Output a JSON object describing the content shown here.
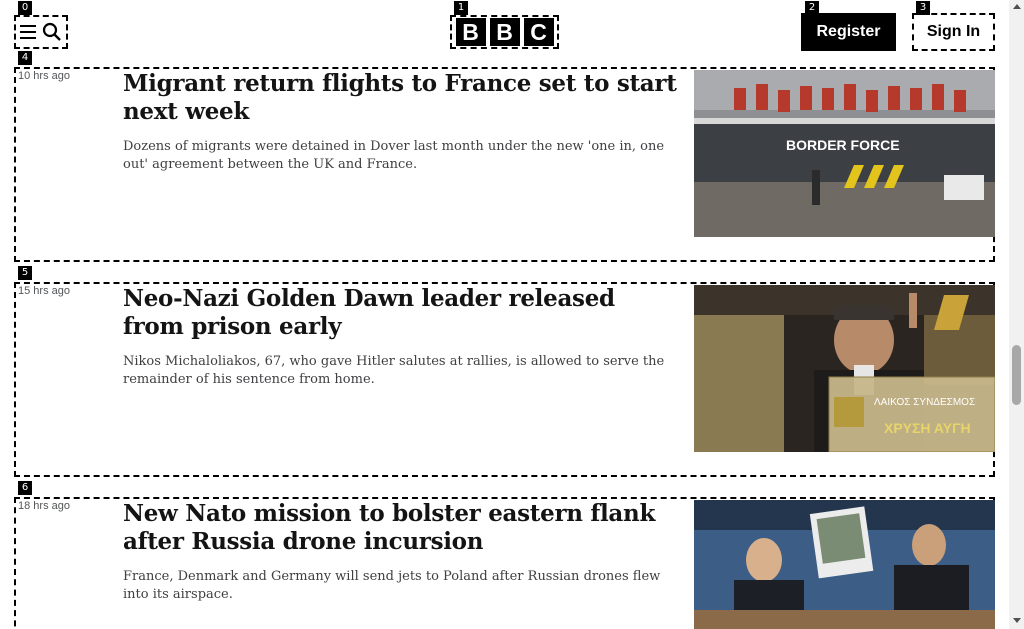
{
  "header": {
    "bbc_letters": [
      "B",
      "B",
      "C"
    ],
    "register_label": "Register",
    "signin_label": "Sign In"
  },
  "markers": [
    "0",
    "1",
    "2",
    "3",
    "4",
    "5",
    "6"
  ],
  "articles": [
    {
      "time": "10 hrs ago",
      "headline": "Migrant return flights to France set to start next week",
      "summary": "Dozens of migrants were detained in Dover last month under the new 'one in, one out' agreement between the UK and France.",
      "image_text": "BORDER FORCE"
    },
    {
      "time": "15 hrs ago",
      "headline": "Neo-Nazi Golden Dawn leader released from prison early",
      "summary": "Nikos Michaloliakos, 67, who gave Hitler salutes at rallies, is allowed to serve the remainder of his sentence from home.",
      "image_text_1": "ΛΑΙΚΟΣ ΣΥΝΔΕΣΜΟΣ",
      "image_text_2": "ΧΡΥΣΗ ΑΥΓΗ"
    },
    {
      "time": "18 hrs ago",
      "headline": "New Nato mission to bolster eastern flank after Russia drone incursion",
      "summary": "France, Denmark and Germany will send jets to Poland after Russian drones flew into its airspace."
    }
  ],
  "colors": {
    "brand": "#000000",
    "text": "#141414",
    "muted": "#545658"
  }
}
